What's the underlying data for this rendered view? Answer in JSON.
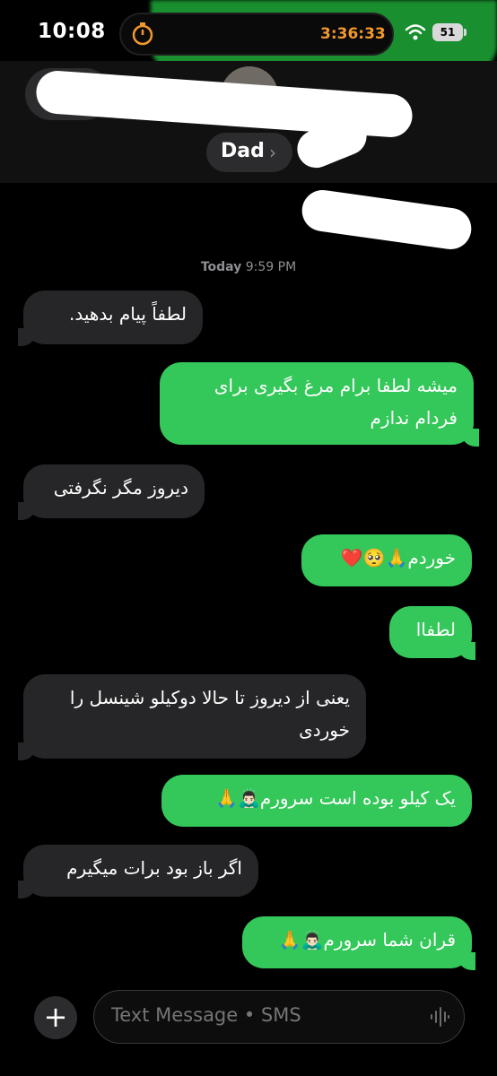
{
  "status_bar": {
    "time": "10:08",
    "timer": "3:36:33",
    "battery": "51"
  },
  "header": {
    "back_count": "1",
    "contact_name": "Dad"
  },
  "timestamp": {
    "day": "Today",
    "time": "9:59 PM"
  },
  "messages": [
    {
      "dir": "in",
      "text": "لطفاً پیام بدهید."
    },
    {
      "dir": "out",
      "text": "میشه لطفا برام مرغ بگیری برای فردام ندازم"
    },
    {
      "dir": "in",
      "text": "دیروز مگر نگرفتی"
    },
    {
      "dir": "out",
      "text": "خوردم🙏🥺❤️"
    },
    {
      "dir": "out",
      "text": "لطفاا"
    },
    {
      "dir": "in",
      "text": "یعنی از دیروز تا حالا دوکیلو شینسل را خوردی"
    },
    {
      "dir": "out",
      "text": "یک کیلو بوده است سرورم🙇🏻‍♂️🙏"
    },
    {
      "dir": "in",
      "text": "اگر باز بود برات میگیرم"
    },
    {
      "dir": "out",
      "text": "قران شما سرورم🙇🏻‍♂️🙏"
    }
  ],
  "composer": {
    "placeholder": "Text Message • SMS"
  },
  "colors": {
    "incoming": "#262628",
    "outgoing": "#34c759",
    "timer": "#f2992e"
  }
}
